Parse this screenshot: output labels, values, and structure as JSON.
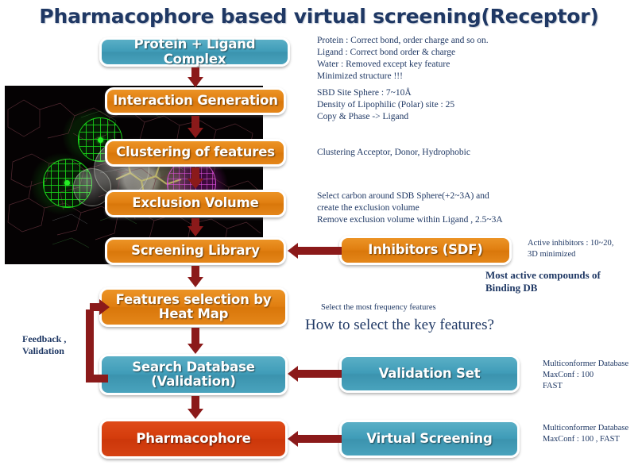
{
  "title": "Pharmacophore based virtual screening(Receptor)",
  "colors": {
    "title_text": "#1f3864",
    "teal": "#3f9cb8",
    "orange": "#e07e10",
    "red": "#d43c0c",
    "arrow": "#8b1a1a",
    "note_text": "#1f3864",
    "background": "#ffffff"
  },
  "nodes": [
    {
      "id": "protein-ligand-complex",
      "label": "Protein + Ligand Complex",
      "color": "teal"
    },
    {
      "id": "interaction-generation",
      "label": "Interaction Generation",
      "color": "orange"
    },
    {
      "id": "clustering-of-features",
      "label": "Clustering of features",
      "color": "orange"
    },
    {
      "id": "exclusion-volume",
      "label": "Exclusion Volume",
      "color": "orange"
    },
    {
      "id": "screening-library",
      "label": "Screening Library",
      "color": "orange"
    },
    {
      "id": "features-selection-heat-map",
      "label": "Features selection by Heat Map",
      "color": "orange"
    },
    {
      "id": "search-database-validation",
      "label": "Search Database (Validation)",
      "color": "teal"
    },
    {
      "id": "pharmacophore",
      "label": "Pharmacophore",
      "color": "red"
    },
    {
      "id": "inhibitors-sdf",
      "label": "Inhibitors (SDF)",
      "color": "orange"
    },
    {
      "id": "validation-set",
      "label": "Validation Set",
      "color": "teal"
    },
    {
      "id": "virtual-screening",
      "label": "Virtual Screening",
      "color": "teal"
    }
  ],
  "notes": {
    "complex": "Protein : Correct bond, order charge  and so on.\nLigand : Correct bond order & charge\nWater : Removed except key feature\nMinimized structure !!!",
    "interaction": "SBD Site Sphere : 7~10Å\nDensity of Lipophilic (Polar)  site : 25\nCopy & Phase -> Ligand",
    "clustering": "Clustering  Acceptor, Donor, Hydrophobic",
    "exclusion": "Select carbon around SDB Sphere(+2~3A) and\ncreate the exclusion volume\nRemove exclusion volume  within Ligand , 2.5~3A",
    "inhibitors": "Active inhibitors : 10~20,\n3D minimized",
    "binding_db": "Most active compounds of\nBinding DB",
    "features": "Select the most  frequency features",
    "question": "How to select the key features?",
    "feedback": "Feedback ,\nValidation",
    "validation_set": "Multiconformer Database\nMaxConf : 100\nFAST",
    "virtual_screening": "Multiconformer Database\nMaxConf : 100 , FAST"
  }
}
